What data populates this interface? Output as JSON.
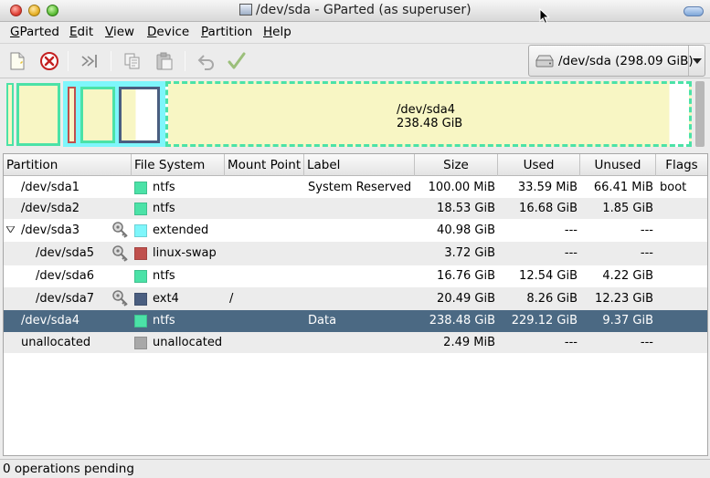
{
  "window": {
    "title": "/dev/sda - GParted (as superuser)"
  },
  "menubar": {
    "items": [
      {
        "first": "G",
        "rest": "Parted"
      },
      {
        "first": "E",
        "rest": "dit"
      },
      {
        "first": "V",
        "rest": "iew"
      },
      {
        "first": "D",
        "rest": "evice"
      },
      {
        "first": "P",
        "rest": "artition"
      },
      {
        "first": "H",
        "rest": "elp"
      }
    ]
  },
  "toolbar": {
    "buttons": [
      "new-icon",
      "delete-icon",
      "resize-move-icon",
      "copy-icon",
      "paste-icon",
      "undo-icon",
      "apply-icon"
    ]
  },
  "device": {
    "label": "/dev/sda  (298.09 GiB)"
  },
  "graph": {
    "big_label_name": "/dev/sda4",
    "big_label_size": "238.48 GiB"
  },
  "colors": {
    "ntfs": "#4be2a7",
    "extended": "#7ef6fb",
    "linux_swap": "#c0504d",
    "ext4": "#4a5e80",
    "unallocated": "#a8a8a8",
    "selected_row": "#4b6983"
  },
  "table": {
    "headers": {
      "partition": "Partition",
      "filesystem": "File System",
      "mountpoint": "Mount Point",
      "label": "Label",
      "size": "Size",
      "used": "Used",
      "unused": "Unused",
      "flags": "Flags"
    },
    "rows": [
      {
        "partition": "/dev/sda1",
        "filesystem": "ntfs",
        "mountpoint": "",
        "label": "System Reserved",
        "size": "100.00 MiB",
        "used": "33.59 MiB",
        "unused": "66.41 MiB",
        "flags": "boot"
      },
      {
        "partition": "/dev/sda2",
        "filesystem": "ntfs",
        "mountpoint": "",
        "label": "",
        "size": "18.53 GiB",
        "used": "16.68 GiB",
        "unused": "1.85 GiB",
        "flags": ""
      },
      {
        "partition": "/dev/sda3",
        "filesystem": "extended",
        "mountpoint": "",
        "label": "",
        "size": "40.98 GiB",
        "used": "---",
        "unused": "---",
        "flags": ""
      },
      {
        "partition": "/dev/sda5",
        "filesystem": "linux-swap",
        "mountpoint": "",
        "label": "",
        "size": "3.72 GiB",
        "used": "---",
        "unused": "---",
        "flags": ""
      },
      {
        "partition": "/dev/sda6",
        "filesystem": "ntfs",
        "mountpoint": "",
        "label": "",
        "size": "16.76 GiB",
        "used": "12.54 GiB",
        "unused": "4.22 GiB",
        "flags": ""
      },
      {
        "partition": "/dev/sda7",
        "filesystem": "ext4",
        "mountpoint": "/",
        "label": "",
        "size": "20.49 GiB",
        "used": "8.26 GiB",
        "unused": "12.23 GiB",
        "flags": ""
      },
      {
        "partition": "/dev/sda4",
        "filesystem": "ntfs",
        "mountpoint": "",
        "label": "Data",
        "size": "238.48 GiB",
        "used": "229.12 GiB",
        "unused": "9.37 GiB",
        "flags": ""
      },
      {
        "partition": "unallocated",
        "filesystem": "unallocated",
        "mountpoint": "",
        "label": "",
        "size": "2.49 MiB",
        "used": "---",
        "unused": "---",
        "flags": ""
      }
    ]
  },
  "status": {
    "text": "0 operations pending"
  }
}
